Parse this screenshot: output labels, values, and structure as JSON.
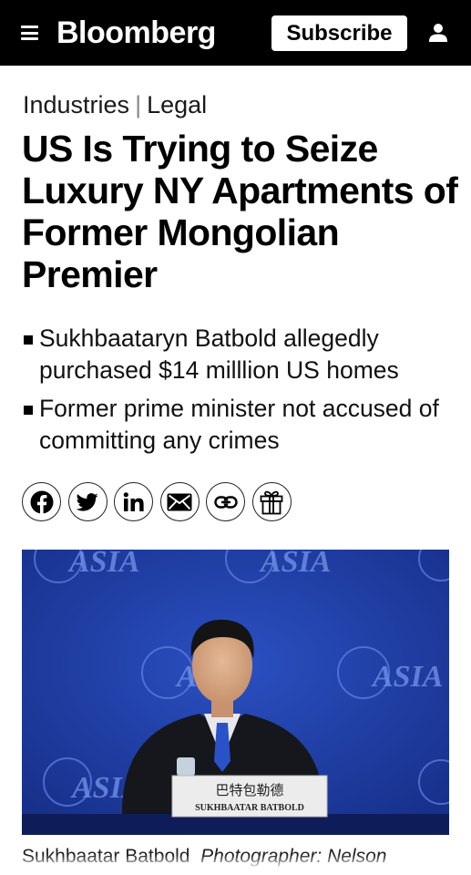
{
  "header": {
    "logo": "Bloomberg",
    "subscribe_label": "Subscribe",
    "menu_icon": "hamburger-menu-icon",
    "user_icon": "user-account-icon"
  },
  "article": {
    "kicker_primary": "Industries",
    "kicker_separator": "|",
    "kicker_secondary": "Legal",
    "headline": "US Is Trying to Seize Luxury NY Apartments of Former Mongolian Premier",
    "bullets": [
      "Sukhbaataryn Batbold allegedly purchased $14 milllion US homes",
      "Former prime minister not accused of committing any crimes"
    ],
    "share_icons": [
      "facebook-icon",
      "twitter-icon",
      "linkedin-icon",
      "email-icon",
      "link-icon",
      "gift-icon"
    ]
  },
  "photo": {
    "backdrop_text": "ASIA",
    "nameplate_chinese": "巴特包勒德",
    "nameplate_latin": "SUKHBAATAR BATBOLD",
    "backdrop_color": "#1f3ea3"
  },
  "caption": {
    "name": "Sukhbaatar Batbold",
    "credit": "Photographer: Nelson"
  }
}
